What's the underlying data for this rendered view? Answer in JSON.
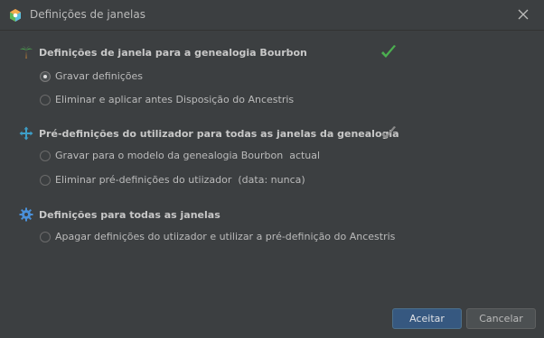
{
  "window": {
    "title": "Definições de janelas"
  },
  "sections": [
    {
      "heading": "Definições de janela para a genealogia Bourbon",
      "icon": "palm-tree-icon",
      "status_color": "#4caf50",
      "options": [
        {
          "label": "Gravar definições",
          "checked": true
        },
        {
          "label": "Eliminar e aplicar antes Disposição do Ancestris",
          "checked": false
        }
      ]
    },
    {
      "heading": "Pré-definições do utilizador para todas as janelas da genealogia",
      "icon": "move-arrows-icon",
      "status_color": "#8a8a8a",
      "options": [
        {
          "label": "Gravar para o modelo da genealogia Bourbon  actual",
          "checked": false
        },
        {
          "label": "Eliminar pré-definições do utiizador  (data: nunca)",
          "checked": false
        }
      ]
    },
    {
      "heading": "Definições para todas as janelas",
      "icon": "gear-icon",
      "options": [
        {
          "label": "Apagar definições do utiizador e utilizar a pré-definição do Ancestris",
          "checked": false
        }
      ]
    }
  ],
  "buttons": {
    "accept": "Aceitar",
    "cancel": "Cancelar"
  }
}
